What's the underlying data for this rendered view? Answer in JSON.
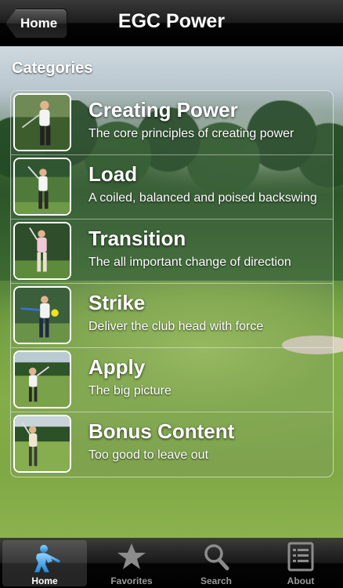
{
  "navbar": {
    "back_label": "Home",
    "title": "EGC Power"
  },
  "section": {
    "header": "Categories"
  },
  "categories": [
    {
      "title": "Creating Power",
      "subtitle": "The core principles of creating power"
    },
    {
      "title": "Load",
      "subtitle": "A coiled, balanced and poised backswing"
    },
    {
      "title": "Transition",
      "subtitle": "The all important change of direction"
    },
    {
      "title": "Strike",
      "subtitle": "Deliver the club head with force"
    },
    {
      "title": "Apply",
      "subtitle": "The big picture"
    },
    {
      "title": "Bonus Content",
      "subtitle": "Too good to leave out"
    }
  ],
  "tabbar": {
    "active": "Home",
    "tabs": [
      {
        "label": "Home",
        "icon": "golfer-icon"
      },
      {
        "label": "Favorites",
        "icon": "star-icon"
      },
      {
        "label": "Search",
        "icon": "magnifier-icon"
      },
      {
        "label": "About",
        "icon": "document-icon"
      }
    ]
  },
  "colors": {
    "nav_bg": "#000000",
    "active_tab_icon": "#3fa9f5",
    "text": "#ffffff"
  }
}
